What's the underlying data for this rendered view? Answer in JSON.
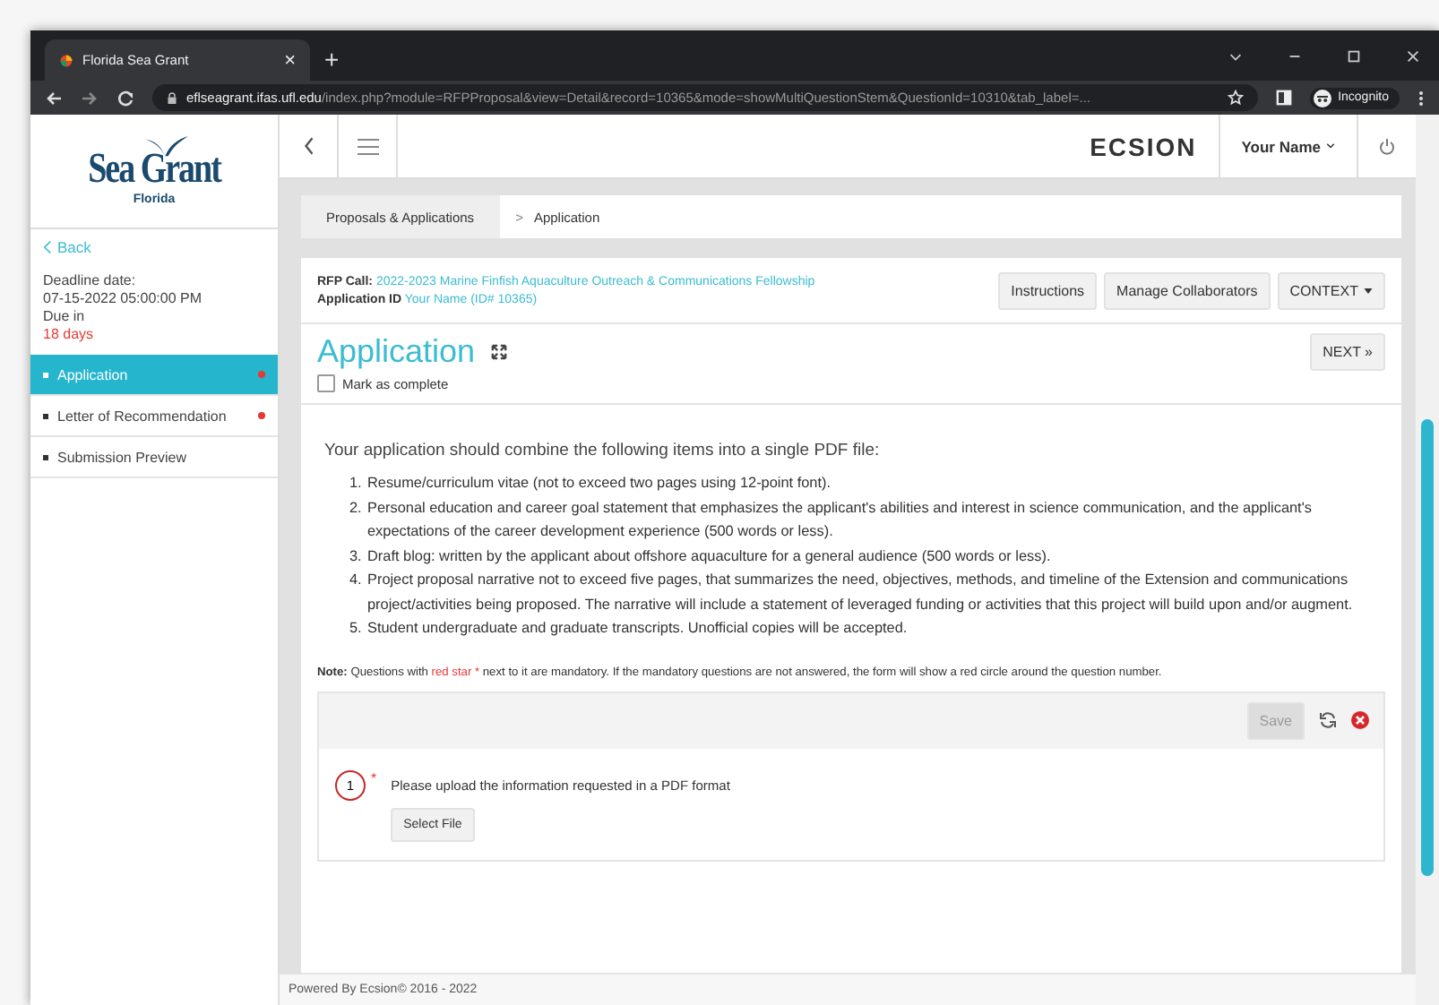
{
  "browser": {
    "tab_title": "Florida Sea Grant",
    "tab_close": "×",
    "new_tab": "+",
    "url_host": "eflseagrant.ifas.ufl.edu",
    "url_path": "/index.php?module=RFPProposal&view=Detail&record=10365&mode=showMultiQuestionStem&QuestionId=10310&tab_label=...",
    "profile": "Incognito"
  },
  "header": {
    "brand": "ECSION",
    "user": "Your Name"
  },
  "sidebar": {
    "logo_line1": "Sea Grant",
    "logo_line2": "Florida",
    "back": "Back",
    "deadline_label": "Deadline date:",
    "deadline": "07-15-2022 05:00:00 PM",
    "due_label": "Due in",
    "due": "18 days",
    "items": [
      {
        "label": "Application",
        "selected": true,
        "incomplete": true
      },
      {
        "label": "Letter of Recommendation",
        "selected": false,
        "incomplete": true
      },
      {
        "label": "Submission Preview",
        "selected": false,
        "incomplete": false
      }
    ]
  },
  "breadcrumb": [
    "Proposals & Applications",
    "Application"
  ],
  "breadcrumb_separator": ">",
  "rfp": {
    "call_label": "RFP Call:",
    "call": "2022-2023 Marine Finfish Aquaculture Outreach & Communications Fellowship",
    "id_label": "Application ID",
    "id": "Your Name (ID# 10365)"
  },
  "actions": [
    "Instructions",
    "Manage Collaborators",
    "CONTEXT"
  ],
  "title": "Application",
  "next": "NEXT »",
  "mark_complete": {
    "label": "Mark as complete",
    "checked": false
  },
  "intro": "Your application should combine the following items into a single PDF file:",
  "items": [
    {
      "number": "1.",
      "text": "Resume/curriculum vitae (not to exceed two pages using 12-point font)."
    },
    {
      "number": "2.",
      "text": "Personal education and career goal statement that emphasizes the applicant's abilities and interest in science communication, and the applicant's expectations of the career development experience (500 words or less)."
    },
    {
      "number": "3.",
      "text": "Draft blog: written by the applicant about offshore aquaculture for a general audience (500 words or less)."
    },
    {
      "number": "4.",
      "text": "Project proposal narrative not to exceed five pages, that summarizes the need, objectives, methods, and timeline of the Extension and communications project/activities being proposed. The narrative will include a statement of leveraged funding or activities that this project will build upon and/or augment."
    },
    {
      "number": "5.",
      "text": "Student undergraduate and graduate transcripts. Unofficial copies will be accepted."
    }
  ],
  "note": {
    "label": "Note:",
    "before": "Questions with",
    "red": "red star",
    "star": "*",
    "after": "next to it are mandatory. If the mandatory questions are not answered, the form will show a red circle around the question number."
  },
  "save": {
    "label": "Save",
    "disabled": true
  },
  "question": {
    "number": "1",
    "required": true,
    "text": "Please upload the information requested in a PDF format",
    "button": "Select File"
  },
  "footer": "Powered By Ecsion© 2016 - 2022"
}
